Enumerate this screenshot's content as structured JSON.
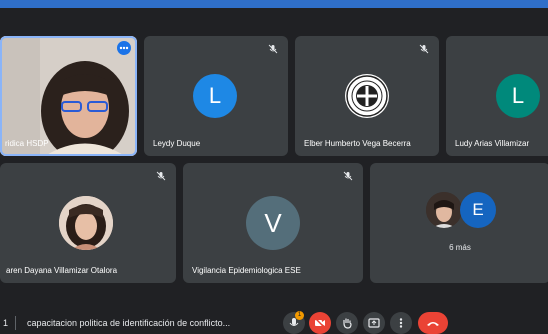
{
  "participants": {
    "p1": {
      "name": "ridica HSDP"
    },
    "p2": {
      "name": "Leydy Duque",
      "initial": "L",
      "color": "#1e88e5"
    },
    "p3": {
      "name": "Elber Humberto Vega Becerra"
    },
    "p4": {
      "name": "Ludy Arias Villamizar",
      "initial": "L",
      "color": "#00897b"
    },
    "p5": {
      "name": "aren Dayana Villamizar Otalora"
    },
    "p6": {
      "name": "Vigilancia Epidemiologica ESE",
      "initial": "V",
      "color": "#546e7a"
    },
    "p7": {
      "more_label": "6 más",
      "initial": "E",
      "color": "#1565c0"
    }
  },
  "meeting": {
    "time_fragment": "1",
    "title": "capacitacion politica de identificación de conflicto...",
    "badge_count": "1"
  },
  "icons": {
    "muted": "mic-off-icon",
    "controls": [
      "mic-icon",
      "camera-off-icon",
      "raise-hand-icon",
      "present-icon",
      "more-vert-icon",
      "hang-up-icon"
    ]
  },
  "colors": {
    "accent": "#8ab4f8",
    "danger": "#ea4335",
    "badge": "#f29900"
  }
}
